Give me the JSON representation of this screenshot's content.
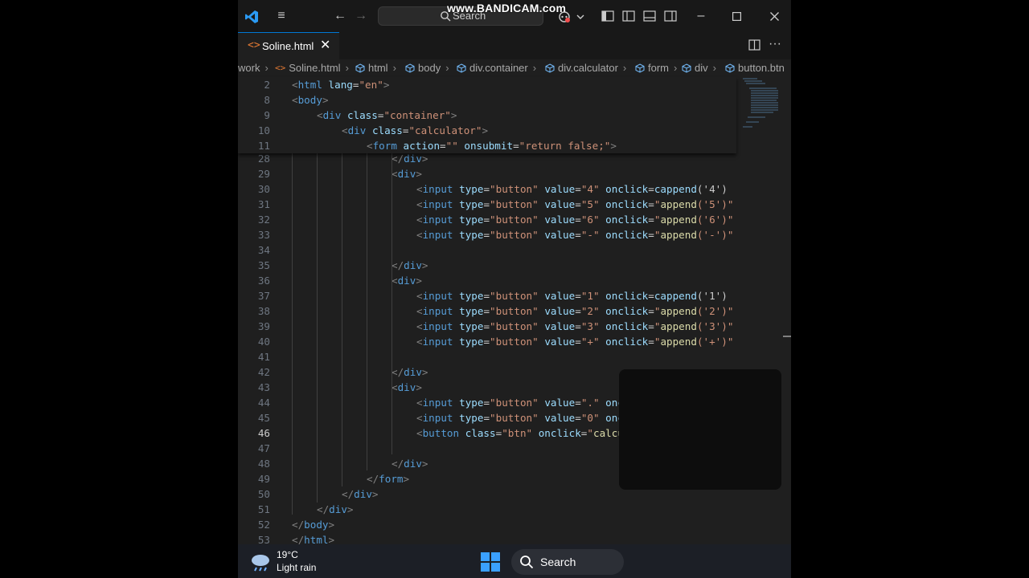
{
  "titlebar": {
    "search_label": "Search",
    "watermark": "www.BANDICAM.com"
  },
  "tabs": [
    {
      "label": "Soline.html",
      "icon": "html-file-icon"
    }
  ],
  "breadcrumb": [
    "work",
    "Soline.html",
    "html",
    "body",
    "div.container",
    "div.calculator",
    "form",
    "div",
    "button.btn"
  ],
  "editor": {
    "current_line": "46",
    "sticky_lines": [
      {
        "n": "2",
        "text": "<html lang=\"en\">"
      },
      {
        "n": "8",
        "text": "<body>"
      },
      {
        "n": "9",
        "text": "<div class=\"container\">"
      },
      {
        "n": "10",
        "text": "<div class=\"calculator\">"
      },
      {
        "n": "11",
        "text": "<form action=\"\" onsubmit=\"return false;\">"
      }
    ],
    "lines": [
      {
        "n": "28",
        "text": "</div>"
      },
      {
        "n": "29",
        "text": "<div>"
      },
      {
        "n": "30",
        "text": "<input type=\"button\" value=\"4\" onclick=\"cappend('4')"
      },
      {
        "n": "31",
        "text": "<input type=\"button\" value=\"5\" onclick=\"append('5')\""
      },
      {
        "n": "32",
        "text": "<input type=\"button\" value=\"6\" onclick=\"append('6')\""
      },
      {
        "n": "33",
        "text": "<input type=\"button\" value=\"-\" onclick=\"append('-')\""
      },
      {
        "n": "34",
        "text": ""
      },
      {
        "n": "35",
        "text": "</div>"
      },
      {
        "n": "36",
        "text": "<div>"
      },
      {
        "n": "37",
        "text": "<input type=\"button\" value=\"1\" onclick=\"cappend('1')"
      },
      {
        "n": "38",
        "text": "<input type=\"button\" value=\"2\" onclick=\"append('2')\""
      },
      {
        "n": "39",
        "text": "<input type=\"button\" value=\"3\" onclick=\"append('3')\""
      },
      {
        "n": "40",
        "text": "<input type=\"button\" value=\"+\" onclick=\"append('+')\""
      },
      {
        "n": "41",
        "text": ""
      },
      {
        "n": "42",
        "text": "</div>"
      },
      {
        "n": "43",
        "text": "<div>"
      },
      {
        "n": "44",
        "text": "<input type=\"button\" value=\".\" onclick=\"cappend('.')"
      },
      {
        "n": "45",
        "text": "<input type=\"button\" value=\"0\" onclick=\"append('0')\""
      },
      {
        "n": "46",
        "text": "<button class=\"btn\" onclick=\"calculate()\">=</button>"
      },
      {
        "n": "47",
        "text": ""
      },
      {
        "n": "48",
        "text": "</div>"
      },
      {
        "n": "49",
        "text": "</form>"
      },
      {
        "n": "50",
        "text": "</div>"
      },
      {
        "n": "51",
        "text": "</div>"
      },
      {
        "n": "52",
        "text": "</body>"
      },
      {
        "n": "53",
        "text": "</html>"
      }
    ]
  },
  "taskbar": {
    "temperature": "19°C",
    "condition": "Light rain",
    "search_label": "Search"
  },
  "colors": {
    "accent": "#0078d4",
    "tag": "#569cd6",
    "attribute": "#9cdcfe",
    "string": "#ce9178",
    "function": "#dcdcaa",
    "html_icon": "#e37933"
  }
}
